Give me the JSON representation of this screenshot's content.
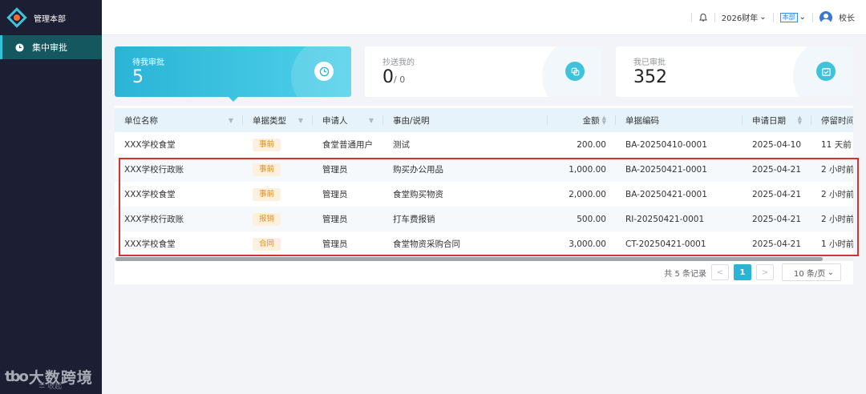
{
  "sidebar": {
    "brand_title": "管理本部",
    "nav": [
      {
        "label": "集中审批",
        "icon": "clock-icon",
        "active": true
      }
    ],
    "footer_label": "收起",
    "watermark": {
      "mark": "tbo",
      "text": "大数跨境"
    }
  },
  "header": {
    "fiscal_year": "2026财年",
    "org_tag": "本部",
    "user": "校长"
  },
  "cards": [
    {
      "label": "待我审批",
      "value": "5",
      "suffix": "",
      "icon": "clock-icon",
      "active": true
    },
    {
      "label": "抄送我的",
      "value": "0",
      "suffix": "/ 0",
      "icon": "copy-icon",
      "active": false
    },
    {
      "label": "我已审批",
      "value": "352",
      "suffix": "",
      "icon": "calendar-check-icon",
      "active": false
    }
  ],
  "table": {
    "columns": [
      "单位名称",
      "单据类型",
      "申请人",
      "事由/说明",
      "金额",
      "单据编码",
      "申请日期",
      "停留时间"
    ],
    "rows": [
      {
        "unit": "XXX学校食堂",
        "type": "事前",
        "applicant": "食堂普通用户",
        "reason": "测试",
        "amount": "200.00",
        "code": "BA-20250410-0001",
        "date": "2025-04-10",
        "stay": "11 天前"
      },
      {
        "unit": "XXX学校行政账",
        "type": "事前",
        "applicant": "管理员",
        "reason": "购买办公用品",
        "amount": "1,000.00",
        "code": "BA-20250421-0001",
        "date": "2025-04-21",
        "stay": "2 小时前"
      },
      {
        "unit": "XXX学校食堂",
        "type": "事前",
        "applicant": "管理员",
        "reason": "食堂购买物资",
        "amount": "2,000.00",
        "code": "BA-20250421-0001",
        "date": "2025-04-21",
        "stay": "2 小时前"
      },
      {
        "unit": "XXX学校行政账",
        "type": "报销",
        "applicant": "管理员",
        "reason": "打车费报销",
        "amount": "500.00",
        "code": "RI-20250421-0001",
        "date": "2025-04-21",
        "stay": "2 小时前"
      },
      {
        "unit": "XXX学校食堂",
        "type": "合同",
        "applicant": "管理员",
        "reason": "食堂物资采购合同",
        "amount": "3,000.00",
        "code": "CT-20250421-0001",
        "date": "2025-04-21",
        "stay": "1 小时前"
      }
    ]
  },
  "pagination": {
    "total_text": "共 5 条记录",
    "prev": "<",
    "current": "1",
    "next": ">",
    "page_size": "10 条/页"
  },
  "colors": {
    "accent": "#2ab4d6",
    "sidebar_bg": "#1c1f33",
    "badge_text": "#e8891c",
    "badge_bg": "#fdf0dc",
    "highlight": "#d9302c"
  }
}
